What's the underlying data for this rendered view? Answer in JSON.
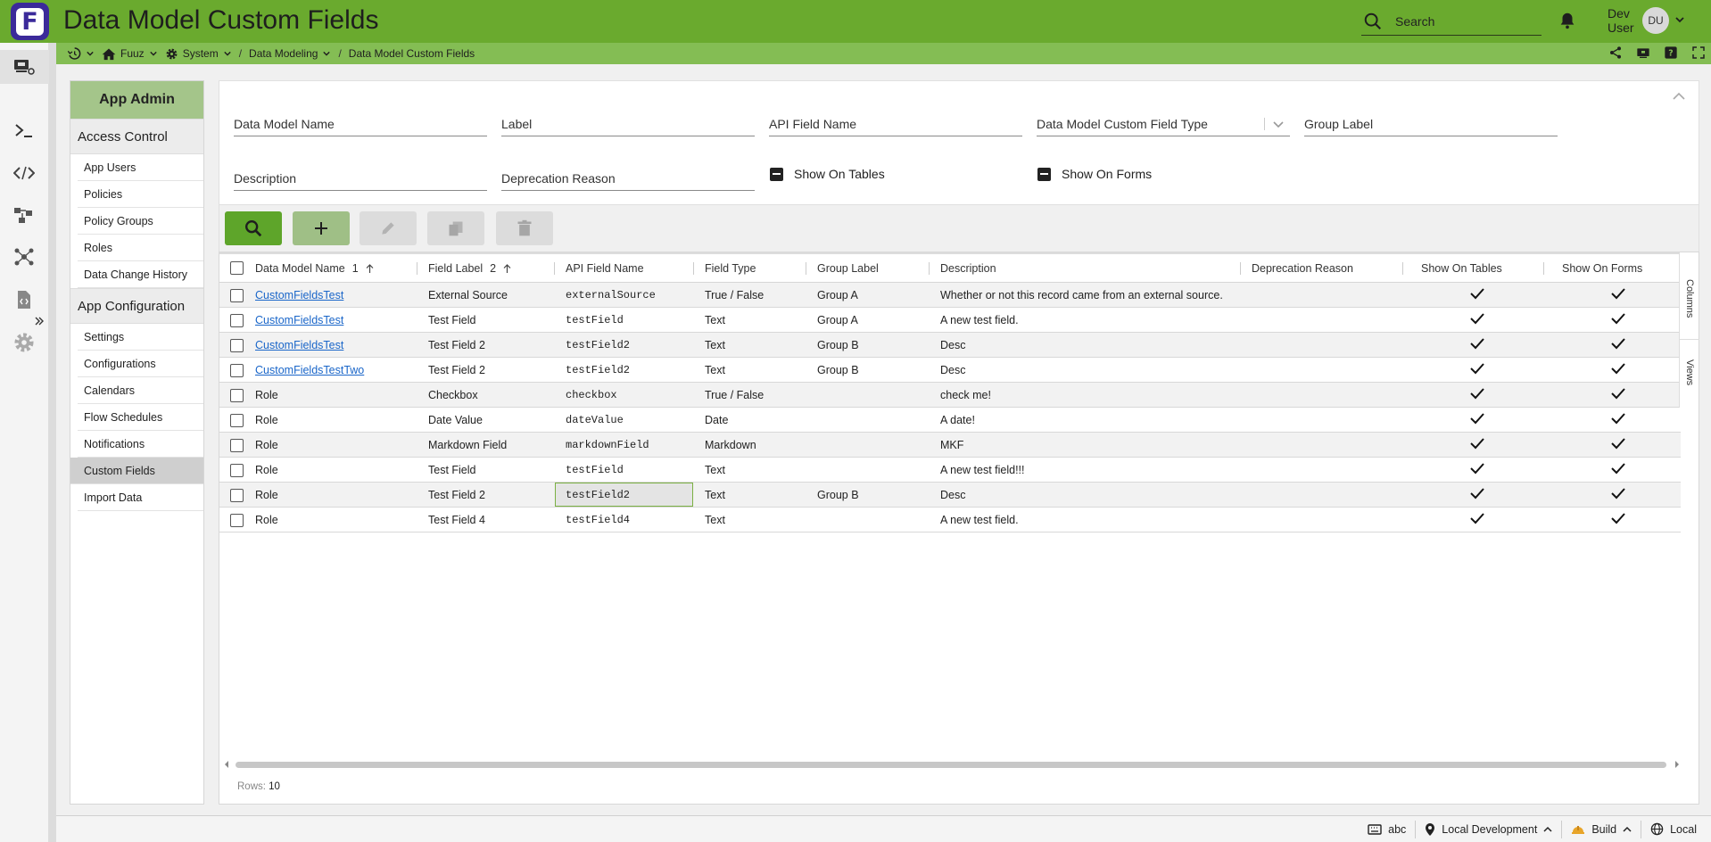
{
  "header": {
    "title": "Data Model Custom Fields",
    "logo_letter": "F",
    "search_placeholder": "Search",
    "user_name_line1": "Dev",
    "user_name_line2": "User",
    "user_initials": "DU"
  },
  "breadcrumb": {
    "items": [
      "Fuuz",
      "System",
      "Data Modeling",
      "Data Model Custom Fields"
    ]
  },
  "nav": {
    "title": "App Admin",
    "sections": [
      {
        "label": "Access Control",
        "items": [
          "App Users",
          "Policies",
          "Policy Groups",
          "Roles",
          "Data Change History"
        ]
      },
      {
        "label": "App Configuration",
        "items": [
          "Settings",
          "Configurations",
          "Calendars",
          "Flow Schedules",
          "Notifications",
          "Custom Fields",
          "Import Data"
        ]
      }
    ],
    "active_item": "Custom Fields"
  },
  "filters": {
    "data_model_name": "Data Model Name",
    "label": "Label",
    "api_field_name": "API Field Name",
    "field_type": "Data Model Custom Field Type",
    "group_label": "Group Label",
    "description": "Description",
    "deprecation_reason": "Deprecation Reason",
    "show_on_tables": "Show On Tables",
    "show_on_forms": "Show On Forms"
  },
  "grid": {
    "columns": [
      "Data Model Name",
      "Field Label",
      "API Field Name",
      "Field Type",
      "Group Label",
      "Description",
      "Deprecation Reason",
      "Show On Tables",
      "Show On Forms"
    ],
    "sort_1": "1",
    "sort_2": "2",
    "rows": [
      {
        "model": "CustomFieldsTest",
        "link": true,
        "label": "External Source",
        "api": "externalSource",
        "type": "True / False",
        "group": "Group A",
        "desc": "Whether or not this record came from an external source.",
        "dep": "",
        "tables": true,
        "forms": true
      },
      {
        "model": "CustomFieldsTest",
        "link": true,
        "label": "Test Field",
        "api": "testField",
        "type": "Text",
        "group": "Group A",
        "desc": "A new test field.",
        "dep": "",
        "tables": true,
        "forms": true
      },
      {
        "model": "CustomFieldsTest",
        "link": true,
        "label": "Test Field 2",
        "api": "testField2",
        "type": "Text",
        "group": "Group B",
        "desc": "Desc",
        "dep": "",
        "tables": true,
        "forms": true
      },
      {
        "model": "CustomFieldsTestTwo",
        "link": true,
        "label": "Test Field 2",
        "api": "testField2",
        "type": "Text",
        "group": "Group B",
        "desc": "Desc",
        "dep": "",
        "tables": true,
        "forms": true
      },
      {
        "model": "Role",
        "link": false,
        "label": "Checkbox",
        "api": "checkbox",
        "type": "True / False",
        "group": "",
        "desc": "check me!",
        "dep": "",
        "tables": true,
        "forms": true
      },
      {
        "model": "Role",
        "link": false,
        "label": "Date Value",
        "api": "dateValue",
        "type": "Date",
        "group": "",
        "desc": "A date!",
        "dep": "",
        "tables": true,
        "forms": true
      },
      {
        "model": "Role",
        "link": false,
        "label": "Markdown Field",
        "api": "markdownField",
        "type": "Markdown",
        "group": "",
        "desc": "MKF",
        "dep": "",
        "tables": true,
        "forms": true
      },
      {
        "model": "Role",
        "link": false,
        "label": "Test Field",
        "api": "testField",
        "type": "Text",
        "group": "",
        "desc": "A new test field!!!",
        "dep": "",
        "tables": true,
        "forms": true
      },
      {
        "model": "Role",
        "link": false,
        "label": "Test Field 2",
        "api": "testField2",
        "type": "Text",
        "group": "Group B",
        "desc": "Desc",
        "dep": "",
        "tables": true,
        "forms": true,
        "selected_api": true
      },
      {
        "model": "Role",
        "link": false,
        "label": "Test Field 4",
        "api": "testField4",
        "type": "Text",
        "group": "",
        "desc": "A new test field.",
        "dep": "",
        "tables": true,
        "forms": true
      }
    ],
    "side_tabs": [
      "Columns",
      "Views"
    ],
    "rows_label": "Rows:",
    "rows_count": "10"
  },
  "statusbar": {
    "tenant": "abc",
    "environment": "Local Development",
    "mode": "Build",
    "locale": "Local"
  },
  "colors": {
    "topbar": "#6aaa2e",
    "crumbbar": "#84bd54",
    "logo": "#3b2a9a",
    "search_button": "#5ea52a",
    "add_button": "#9fbf86",
    "link": "#1a66c9"
  },
  "icons": [
    "history-icon",
    "home-icon",
    "gear-icon",
    "search-icon",
    "bell-icon",
    "share-icon",
    "help-icon",
    "fullscreen-icon",
    "terminal-icon",
    "code-icon",
    "flow-icon",
    "network-icon",
    "file-code-icon",
    "plus-icon",
    "pencil-icon",
    "copy-icon",
    "trash-icon",
    "check-icon",
    "keyboard-icon",
    "location-pin-icon",
    "hardhat-icon",
    "globe-icon"
  ]
}
